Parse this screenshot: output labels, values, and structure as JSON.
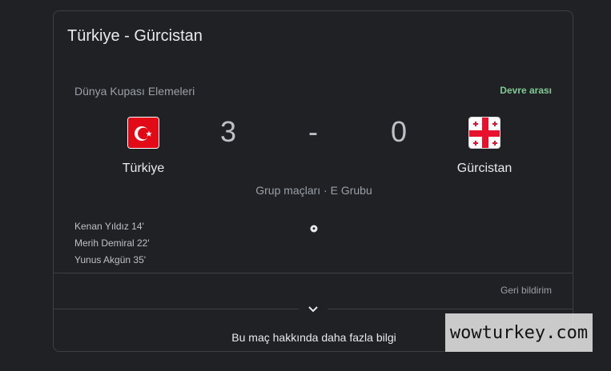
{
  "card": {
    "title": "Türkiye - Gürcistan",
    "competition": "Dünya Kupası Elemeleri",
    "status": "Devre arası",
    "group_info": "Grup maçları · E Grubu",
    "feedback_label": "Geri bildirim",
    "more_info_label": "Bu maç hakkında daha fazla bilgi"
  },
  "home": {
    "name": "Türkiye",
    "score": "3",
    "flag_icon": "turkey-flag-icon"
  },
  "away": {
    "name": "Gürcistan",
    "score": "0",
    "flag_icon": "georgia-flag-icon"
  },
  "score_separator": "-",
  "scorers": [
    "Kenan Yıldız 14'",
    "Merih Demiral 22'",
    "Yunus Akgün 35'"
  ],
  "watermark": "wowturkey.com",
  "colors": {
    "status": "#81c995",
    "background": "#202124",
    "border": "#3c4043"
  }
}
